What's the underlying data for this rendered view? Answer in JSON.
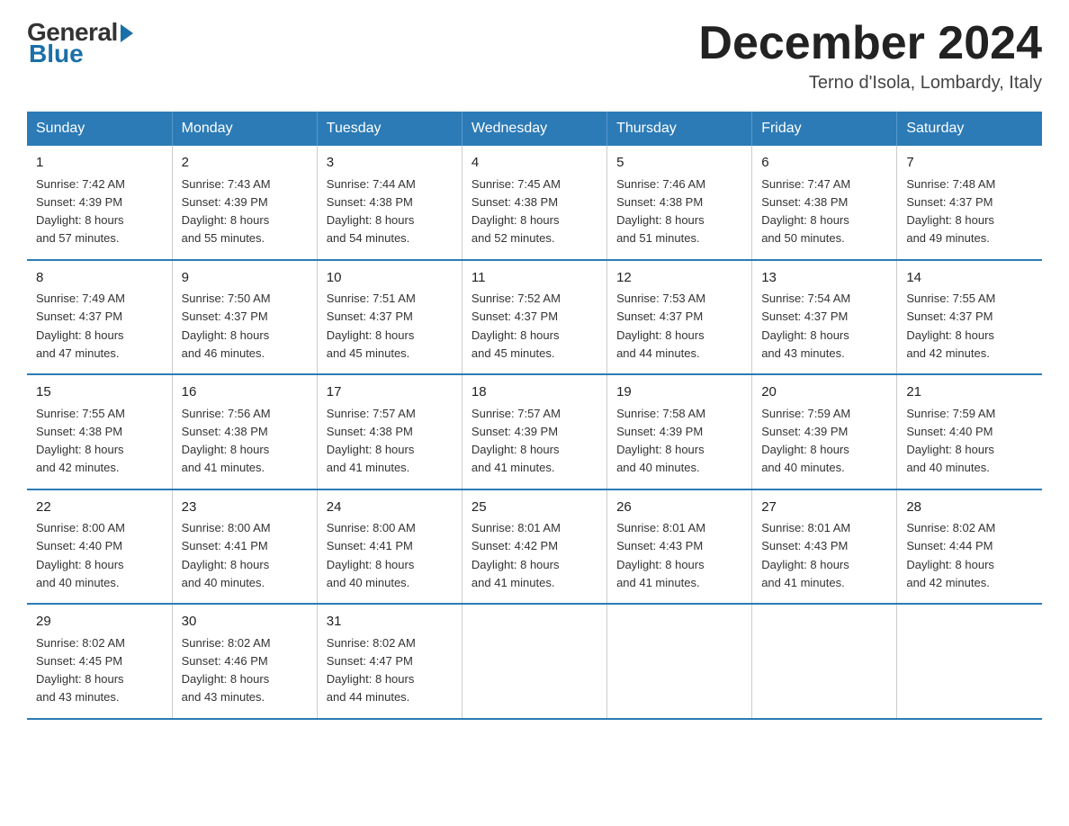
{
  "logo": {
    "general": "General",
    "blue": "Blue"
  },
  "title": "December 2024",
  "subtitle": "Terno d'Isola, Lombardy, Italy",
  "days_of_week": [
    "Sunday",
    "Monday",
    "Tuesday",
    "Wednesday",
    "Thursday",
    "Friday",
    "Saturday"
  ],
  "weeks": [
    [
      {
        "day": "1",
        "sunrise": "7:42 AM",
        "sunset": "4:39 PM",
        "daylight": "8 hours and 57 minutes."
      },
      {
        "day": "2",
        "sunrise": "7:43 AM",
        "sunset": "4:39 PM",
        "daylight": "8 hours and 55 minutes."
      },
      {
        "day": "3",
        "sunrise": "7:44 AM",
        "sunset": "4:38 PM",
        "daylight": "8 hours and 54 minutes."
      },
      {
        "day": "4",
        "sunrise": "7:45 AM",
        "sunset": "4:38 PM",
        "daylight": "8 hours and 52 minutes."
      },
      {
        "day": "5",
        "sunrise": "7:46 AM",
        "sunset": "4:38 PM",
        "daylight": "8 hours and 51 minutes."
      },
      {
        "day": "6",
        "sunrise": "7:47 AM",
        "sunset": "4:38 PM",
        "daylight": "8 hours and 50 minutes."
      },
      {
        "day": "7",
        "sunrise": "7:48 AM",
        "sunset": "4:37 PM",
        "daylight": "8 hours and 49 minutes."
      }
    ],
    [
      {
        "day": "8",
        "sunrise": "7:49 AM",
        "sunset": "4:37 PM",
        "daylight": "8 hours and 47 minutes."
      },
      {
        "day": "9",
        "sunrise": "7:50 AM",
        "sunset": "4:37 PM",
        "daylight": "8 hours and 46 minutes."
      },
      {
        "day": "10",
        "sunrise": "7:51 AM",
        "sunset": "4:37 PM",
        "daylight": "8 hours and 45 minutes."
      },
      {
        "day": "11",
        "sunrise": "7:52 AM",
        "sunset": "4:37 PM",
        "daylight": "8 hours and 45 minutes."
      },
      {
        "day": "12",
        "sunrise": "7:53 AM",
        "sunset": "4:37 PM",
        "daylight": "8 hours and 44 minutes."
      },
      {
        "day": "13",
        "sunrise": "7:54 AM",
        "sunset": "4:37 PM",
        "daylight": "8 hours and 43 minutes."
      },
      {
        "day": "14",
        "sunrise": "7:55 AM",
        "sunset": "4:37 PM",
        "daylight": "8 hours and 42 minutes."
      }
    ],
    [
      {
        "day": "15",
        "sunrise": "7:55 AM",
        "sunset": "4:38 PM",
        "daylight": "8 hours and 42 minutes."
      },
      {
        "day": "16",
        "sunrise": "7:56 AM",
        "sunset": "4:38 PM",
        "daylight": "8 hours and 41 minutes."
      },
      {
        "day": "17",
        "sunrise": "7:57 AM",
        "sunset": "4:38 PM",
        "daylight": "8 hours and 41 minutes."
      },
      {
        "day": "18",
        "sunrise": "7:57 AM",
        "sunset": "4:39 PM",
        "daylight": "8 hours and 41 minutes."
      },
      {
        "day": "19",
        "sunrise": "7:58 AM",
        "sunset": "4:39 PM",
        "daylight": "8 hours and 40 minutes."
      },
      {
        "day": "20",
        "sunrise": "7:59 AM",
        "sunset": "4:39 PM",
        "daylight": "8 hours and 40 minutes."
      },
      {
        "day": "21",
        "sunrise": "7:59 AM",
        "sunset": "4:40 PM",
        "daylight": "8 hours and 40 minutes."
      }
    ],
    [
      {
        "day": "22",
        "sunrise": "8:00 AM",
        "sunset": "4:40 PM",
        "daylight": "8 hours and 40 minutes."
      },
      {
        "day": "23",
        "sunrise": "8:00 AM",
        "sunset": "4:41 PM",
        "daylight": "8 hours and 40 minutes."
      },
      {
        "day": "24",
        "sunrise": "8:00 AM",
        "sunset": "4:41 PM",
        "daylight": "8 hours and 40 minutes."
      },
      {
        "day": "25",
        "sunrise": "8:01 AM",
        "sunset": "4:42 PM",
        "daylight": "8 hours and 41 minutes."
      },
      {
        "day": "26",
        "sunrise": "8:01 AM",
        "sunset": "4:43 PM",
        "daylight": "8 hours and 41 minutes."
      },
      {
        "day": "27",
        "sunrise": "8:01 AM",
        "sunset": "4:43 PM",
        "daylight": "8 hours and 41 minutes."
      },
      {
        "day": "28",
        "sunrise": "8:02 AM",
        "sunset": "4:44 PM",
        "daylight": "8 hours and 42 minutes."
      }
    ],
    [
      {
        "day": "29",
        "sunrise": "8:02 AM",
        "sunset": "4:45 PM",
        "daylight": "8 hours and 43 minutes."
      },
      {
        "day": "30",
        "sunrise": "8:02 AM",
        "sunset": "4:46 PM",
        "daylight": "8 hours and 43 minutes."
      },
      {
        "day": "31",
        "sunrise": "8:02 AM",
        "sunset": "4:47 PM",
        "daylight": "8 hours and 44 minutes."
      },
      null,
      null,
      null,
      null
    ]
  ],
  "labels": {
    "sunrise": "Sunrise:",
    "sunset": "Sunset:",
    "daylight": "Daylight:"
  }
}
